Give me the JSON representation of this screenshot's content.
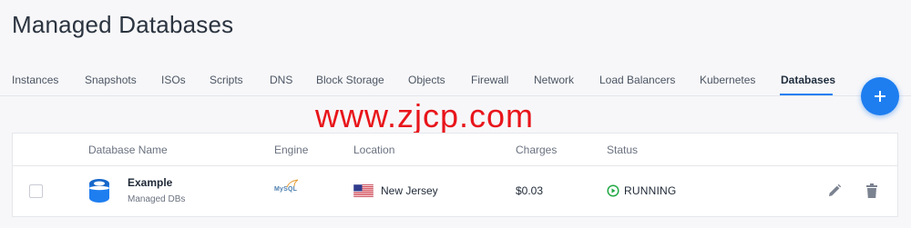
{
  "page": {
    "title": "Managed Databases"
  },
  "tabs": [
    {
      "label": "Instances"
    },
    {
      "label": "Snapshots"
    },
    {
      "label": "ISOs"
    },
    {
      "label": "Scripts"
    },
    {
      "label": "DNS"
    },
    {
      "label": "Block Storage"
    },
    {
      "label": "Objects"
    },
    {
      "label": "Firewall"
    },
    {
      "label": "Network"
    },
    {
      "label": "Load Balancers"
    },
    {
      "label": "Kubernetes"
    },
    {
      "label": "Databases",
      "active": true
    }
  ],
  "fab": {
    "icon": "plus-icon",
    "color": "#1e7ef0"
  },
  "watermark": "www.zjcp.com",
  "table": {
    "columns": [
      "Database Name",
      "Engine",
      "Location",
      "Charges",
      "Status"
    ],
    "rows": [
      {
        "name": "Example",
        "subtitle": "Managed DBs",
        "engine": "MySQL",
        "location": "New Jersey",
        "flag": "us-flag-icon",
        "charges": "$0.03",
        "status": "RUNNING",
        "status_color": "#22a845"
      }
    ]
  },
  "colors": {
    "accent": "#1e7ef0",
    "watermark": "#e8151b"
  }
}
